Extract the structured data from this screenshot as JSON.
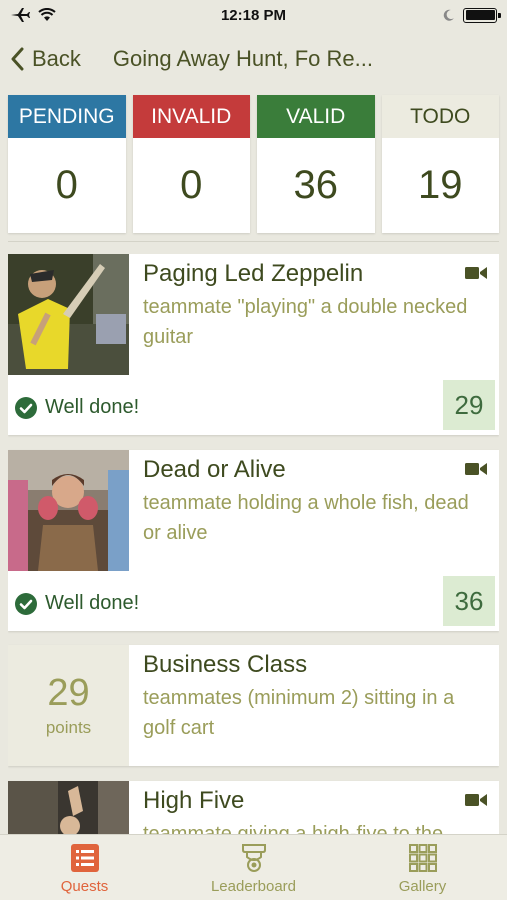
{
  "status_bar": {
    "time": "12:18 PM"
  },
  "nav": {
    "back_label": "Back",
    "title": "Going Away Hunt, Fo Re..."
  },
  "stats": [
    {
      "label": "PENDING",
      "value": "0",
      "color": "#2d77a3"
    },
    {
      "label": "INVALID",
      "value": "0",
      "color": "#c43b3b"
    },
    {
      "label": "VALID",
      "value": "36",
      "color": "#3a7d3a"
    },
    {
      "label": "TODO",
      "value": "19",
      "color": "#ecebe0"
    }
  ],
  "quests": [
    {
      "title": "Paging Led Zeppelin",
      "description": "teammate \"playing\" a double necked guitar",
      "status": "Well done!",
      "points": "29",
      "media": "video-icon"
    },
    {
      "title": "Dead or Alive",
      "description": "teammate holding a whole fish, dead or alive",
      "status": "Well done!",
      "points": "36",
      "media": "video-icon"
    },
    {
      "title": "Business Class",
      "description": "teammates (minimum 2) sitting in a golf cart",
      "points": "29",
      "points_label": "points"
    },
    {
      "title": "High Five",
      "description": "teammate giving a high-five to the",
      "media": "video-icon"
    }
  ],
  "tabs": [
    {
      "label": "Quests",
      "icon": "list-icon",
      "active": true
    },
    {
      "label": "Leaderboard",
      "icon": "trophy-icon",
      "active": false
    },
    {
      "label": "Gallery",
      "icon": "grid-icon",
      "active": false
    }
  ],
  "colors": {
    "accent": "#e0643c",
    "text": "#3e4a1f",
    "muted": "#9a9d5a",
    "done": "#2d5a2d",
    "points_bg": "#dcebd2"
  }
}
